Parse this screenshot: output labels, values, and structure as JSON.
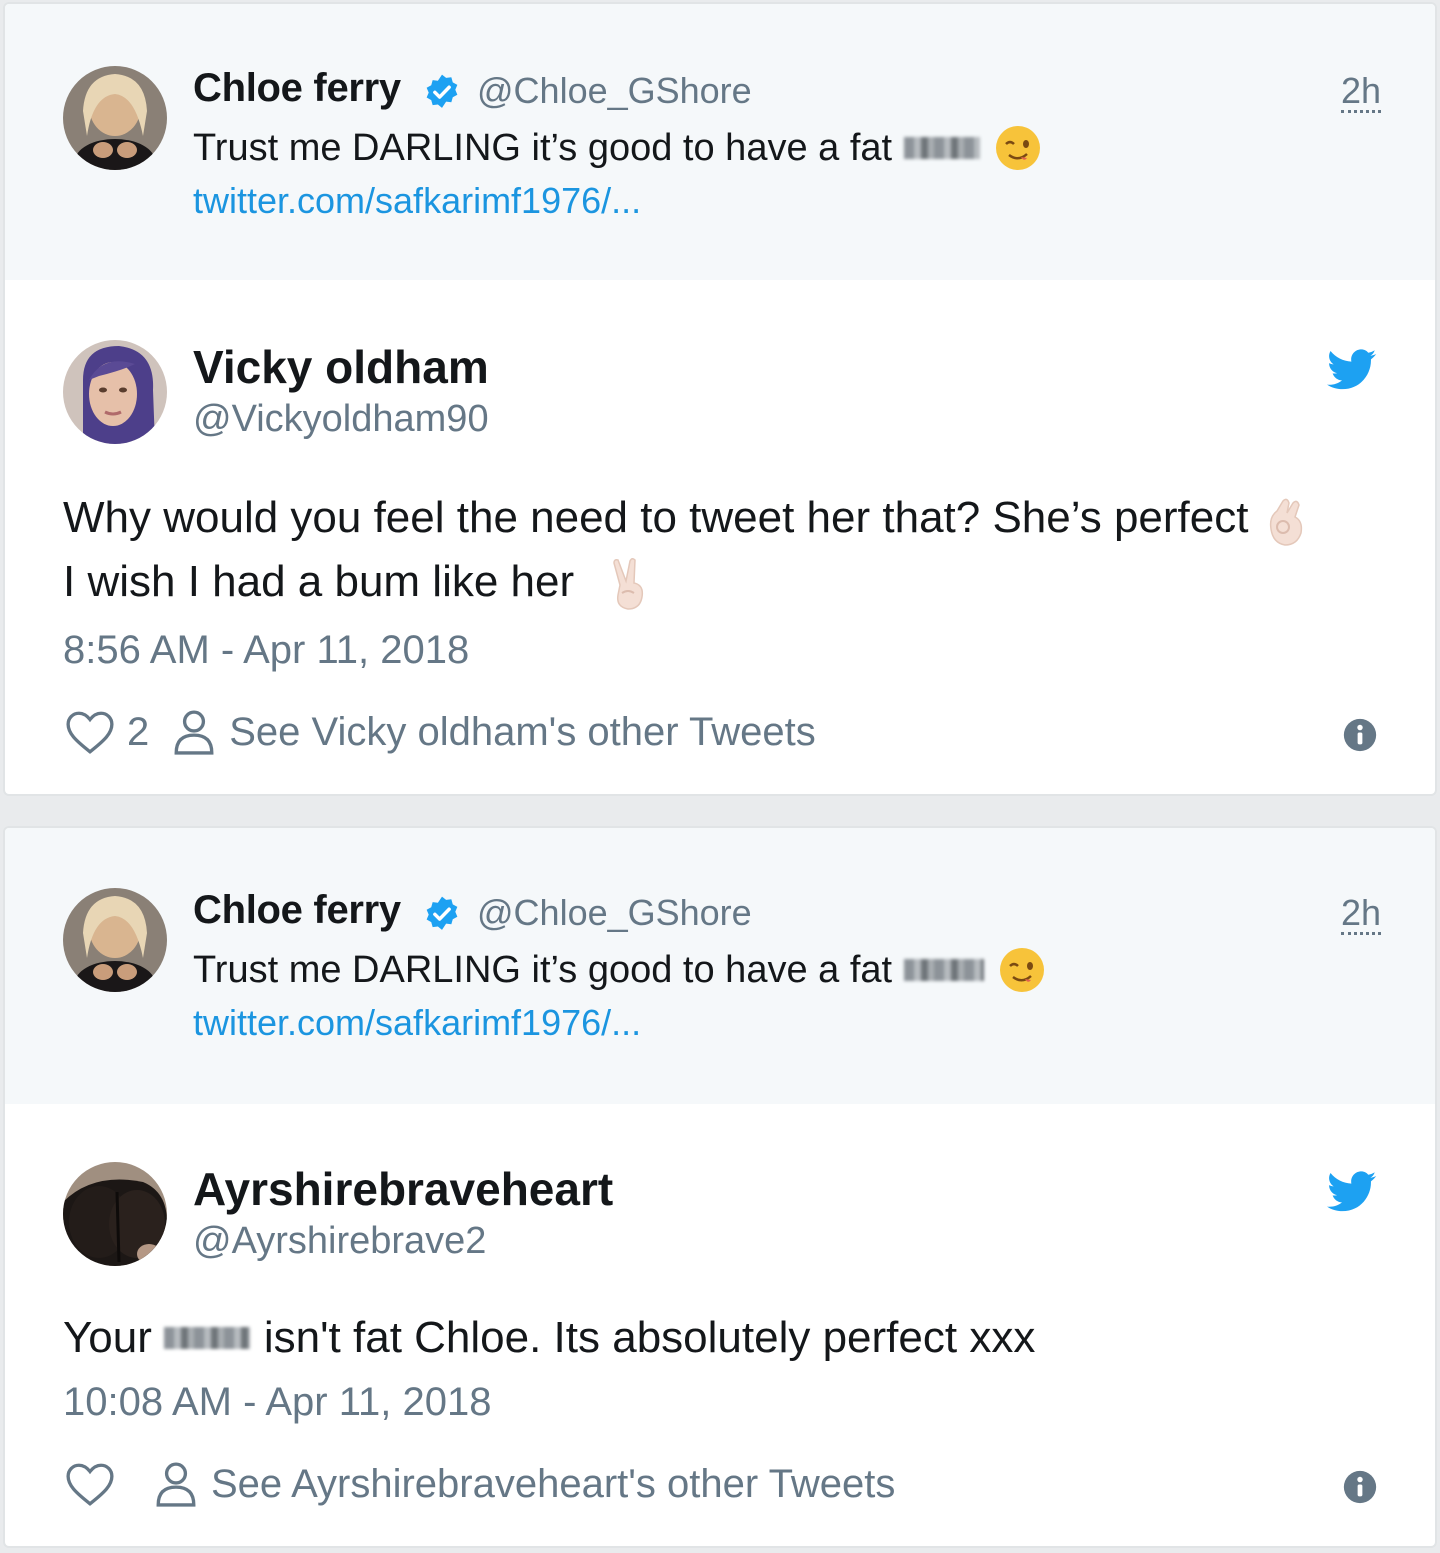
{
  "tweets": [
    {
      "quoted": {
        "name": "Chloe ferry",
        "handle": "@Chloe_GShore",
        "time": "2h",
        "text": "Trust me DARLING it’s good to have a fat",
        "link": "twitter.com/safkarimf1976/..."
      },
      "author": {
        "name": "Vicky oldham",
        "handle": "@Vickyoldham90"
      },
      "text_line1": "Why would you feel the need to tweet her that? She’s perfect",
      "text_line2": "I wish I had a bum like her",
      "timestamp": "8:56 AM - Apr 11, 2018",
      "likes": "2",
      "other_tweets_label": "See Vicky oldham's other Tweets"
    },
    {
      "quoted": {
        "name": "Chloe ferry",
        "handle": "@Chloe_GShore",
        "time": "2h",
        "text": "Trust me DARLING it’s good to have a fat",
        "link": "twitter.com/safkarimf1976/..."
      },
      "author": {
        "name": "Ayrshirebraveheart",
        "handle": "@Ayrshirebrave2"
      },
      "text_before": "Your",
      "text_after": "isn't fat Chloe. Its absolutely perfect xxx",
      "timestamp": "10:08 AM - Apr 11, 2018",
      "likes": "",
      "other_tweets_label": "See Ayrshirebraveheart's other Tweets"
    }
  ],
  "colors": {
    "link_blue": "#1b95e0",
    "twitter_blue": "#1da1f2",
    "secondary_text": "#657786",
    "quoted_bg": "#f5f8fa"
  },
  "icons": [
    "verified-badge-icon",
    "wink-emoji-icon",
    "twitter-bird-icon",
    "ok-hand-emoji-icon",
    "victory-hand-emoji-icon",
    "heart-icon",
    "person-icon",
    "info-icon"
  ]
}
